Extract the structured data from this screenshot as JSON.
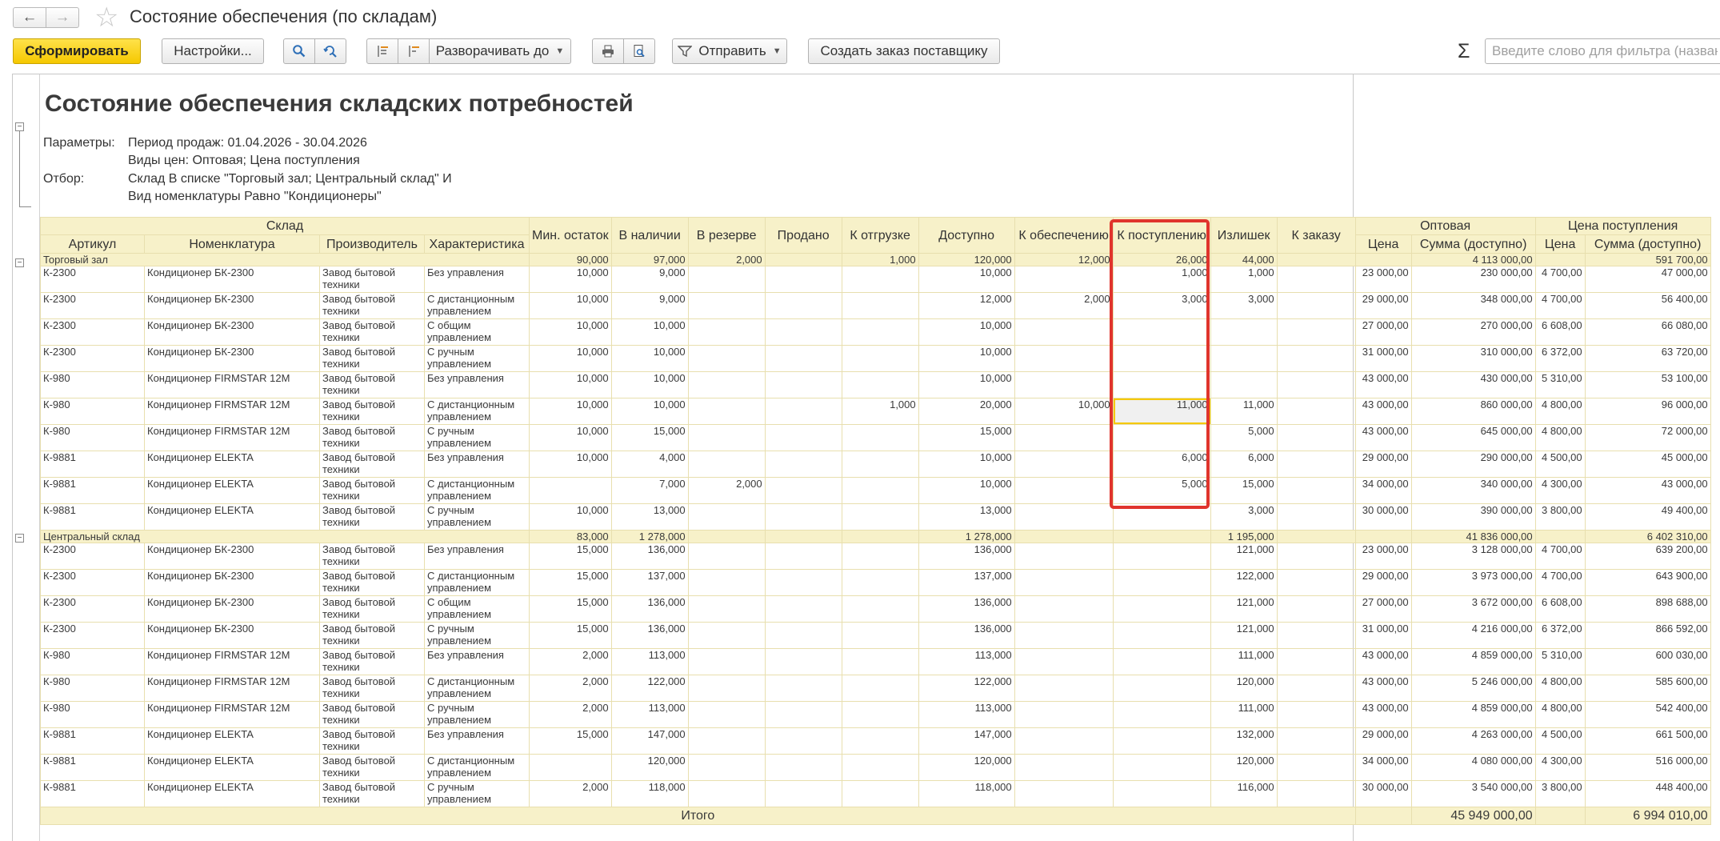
{
  "window": {
    "title": "Состояние обеспечения (по складам)",
    "back_icon": "←",
    "forward_icon": "→",
    "favorite_icon": "☆"
  },
  "toolbar": {
    "generate": "Сформировать",
    "settings": "Настройки...",
    "expand_to": "Разворачивать до",
    "send": "Отправить",
    "create_order": "Создать заказ поставщику",
    "sigma": "Σ",
    "filter_placeholder": "Введите слово для фильтра (назван"
  },
  "report": {
    "title": "Состояние обеспечения складских потребностей",
    "params_label": "Параметры:",
    "params_line1": "Период продаж: 01.04.2026 - 30.04.2026",
    "params_line2": "Виды цен: Оптовая; Цена поступления",
    "filter_label": "Отбор:",
    "filter_line1": "Склад В списке \"Торговый зал; Центральный склад\" И",
    "filter_line2": "Вид номенклатуры Равно \"Кондиционеры\""
  },
  "columns": {
    "warehouse": "Склад",
    "article": "Артикул",
    "item": "Номенклатура",
    "manufacturer": "Производитель",
    "characteristic": "Характеристика",
    "min_stock": "Мин. остаток",
    "in_stock": "В наличии",
    "reserved": "В резерве",
    "sold": "Продано",
    "to_ship": "К отгрузке",
    "available": "Доступно",
    "to_provide": "К обеспечению",
    "to_receive": "К поступлению",
    "surplus": "Излишек",
    "to_order": "К заказу",
    "wholesale": "Оптовая",
    "receipt_price": "Цена поступления",
    "price": "Цена",
    "sum_available": "Сумма (доступно)"
  },
  "groups": [
    {
      "name": "Торговый зал",
      "min": "90,000",
      "stock": "97,000",
      "reserve": "2,000",
      "sold": "",
      "ship": "1,000",
      "avail": "120,000",
      "provide": "12,000",
      "receive": "26,000",
      "surplus": "44,000",
      "order": "",
      "wp": "",
      "ws": "4 113 000,00",
      "rp": "",
      "rs": "591 700,00",
      "rows": [
        {
          "art": "К-2300",
          "item": "Кондиционер БК-2300",
          "man": "Завод бытовой техники",
          "ch": "Без управления",
          "min": "10,000",
          "stock": "9,000",
          "reserve": "",
          "sold": "",
          "ship": "",
          "avail": "10,000",
          "provide": "",
          "receive": "1,000",
          "surplus": "1,000",
          "order": "",
          "wp": "23 000,00",
          "ws": "230 000,00",
          "rp": "4 700,00",
          "rs": "47 000,00"
        },
        {
          "art": "К-2300",
          "item": "Кондиционер БК-2300",
          "man": "Завод бытовой техники",
          "ch": "С дистанционным управлением",
          "min": "10,000",
          "stock": "9,000",
          "reserve": "",
          "sold": "",
          "ship": "",
          "avail": "12,000",
          "provide": "2,000",
          "receive": "3,000",
          "surplus": "3,000",
          "order": "",
          "wp": "29 000,00",
          "ws": "348 000,00",
          "rp": "4 700,00",
          "rs": "56 400,00"
        },
        {
          "art": "К-2300",
          "item": "Кондиционер БК-2300",
          "man": "Завод бытовой техники",
          "ch": "С общим управлением",
          "min": "10,000",
          "stock": "10,000",
          "reserve": "",
          "sold": "",
          "ship": "",
          "avail": "10,000",
          "provide": "",
          "receive": "",
          "surplus": "",
          "order": "",
          "wp": "27 000,00",
          "ws": "270 000,00",
          "rp": "6 608,00",
          "rs": "66 080,00"
        },
        {
          "art": "К-2300",
          "item": "Кондиционер БК-2300",
          "man": "Завод бытовой техники",
          "ch": "С ручным управлением",
          "min": "10,000",
          "stock": "10,000",
          "reserve": "",
          "sold": "",
          "ship": "",
          "avail": "10,000",
          "provide": "",
          "receive": "",
          "surplus": "",
          "order": "",
          "wp": "31 000,00",
          "ws": "310 000,00",
          "rp": "6 372,00",
          "rs": "63 720,00"
        },
        {
          "art": "К-980",
          "item": "Кондиционер FIRMSTAR 12M",
          "man": "Завод бытовой техники",
          "ch": "Без управления",
          "min": "10,000",
          "stock": "10,000",
          "reserve": "",
          "sold": "",
          "ship": "",
          "avail": "10,000",
          "provide": "",
          "receive": "",
          "surplus": "",
          "order": "",
          "wp": "43 000,00",
          "ws": "430 000,00",
          "rp": "5 310,00",
          "rs": "53 100,00"
        },
        {
          "art": "К-980",
          "item": "Кондиционер FIRMSTAR 12M",
          "man": "Завод бытовой техники",
          "ch": "С дистанционным управлением",
          "min": "10,000",
          "stock": "10,000",
          "reserve": "",
          "sold": "",
          "ship": "1,000",
          "avail": "20,000",
          "provide": "10,000",
          "receive": "11,000",
          "surplus": "11,000",
          "order": "",
          "wp": "43 000,00",
          "ws": "860 000,00",
          "rp": "4 800,00",
          "rs": "96 000,00",
          "selected": "yes"
        },
        {
          "art": "К-980",
          "item": "Кондиционер FIRMSTAR 12M",
          "man": "Завод бытовой техники",
          "ch": "С ручным управлением",
          "min": "10,000",
          "stock": "15,000",
          "reserve": "",
          "sold": "",
          "ship": "",
          "avail": "15,000",
          "provide": "",
          "receive": "",
          "surplus": "5,000",
          "order": "",
          "wp": "43 000,00",
          "ws": "645 000,00",
          "rp": "4 800,00",
          "rs": "72 000,00"
        },
        {
          "art": "К-9881",
          "item": "Кондиционер ELEKTA",
          "man": "Завод бытовой техники",
          "ch": "Без управления",
          "min": "10,000",
          "stock": "4,000",
          "reserve": "",
          "sold": "",
          "ship": "",
          "avail": "10,000",
          "provide": "",
          "receive": "6,000",
          "surplus": "6,000",
          "order": "",
          "wp": "29 000,00",
          "ws": "290 000,00",
          "rp": "4 500,00",
          "rs": "45 000,00"
        },
        {
          "art": "К-9881",
          "item": "Кондиционер ELEKTA",
          "man": "Завод бытовой техники",
          "ch": "С дистанционным управлением",
          "min": "",
          "stock": "7,000",
          "reserve": "2,000",
          "sold": "",
          "ship": "",
          "avail": "10,000",
          "provide": "",
          "receive": "5,000",
          "surplus": "15,000",
          "order": "",
          "wp": "34 000,00",
          "ws": "340 000,00",
          "rp": "4 300,00",
          "rs": "43 000,00"
        },
        {
          "art": "К-9881",
          "item": "Кондиционер ELEKTA",
          "man": "Завод бытовой техники",
          "ch": "С ручным управлением",
          "min": "10,000",
          "stock": "13,000",
          "reserve": "",
          "sold": "",
          "ship": "",
          "avail": "13,000",
          "provide": "",
          "receive": "",
          "surplus": "3,000",
          "order": "",
          "wp": "30 000,00",
          "ws": "390 000,00",
          "rp": "3 800,00",
          "rs": "49 400,00"
        }
      ]
    },
    {
      "name": "Центральный склад",
      "min": "83,000",
      "stock": "1 278,000",
      "reserve": "",
      "sold": "",
      "ship": "",
      "avail": "1 278,000",
      "provide": "",
      "receive": "",
      "surplus": "1 195,000",
      "order": "",
      "wp": "",
      "ws": "41 836 000,00",
      "rp": "",
      "rs": "6 402 310,00",
      "rows": [
        {
          "art": "К-2300",
          "item": "Кондиционер БК-2300",
          "man": "Завод бытовой техники",
          "ch": "Без управления",
          "min": "15,000",
          "stock": "136,000",
          "reserve": "",
          "sold": "",
          "ship": "",
          "avail": "136,000",
          "provide": "",
          "receive": "",
          "surplus": "121,000",
          "order": "",
          "wp": "23 000,00",
          "ws": "3 128 000,00",
          "rp": "4 700,00",
          "rs": "639 200,00"
        },
        {
          "art": "К-2300",
          "item": "Кондиционер БК-2300",
          "man": "Завод бытовой техники",
          "ch": "С дистанционным управлением",
          "min": "15,000",
          "stock": "137,000",
          "reserve": "",
          "sold": "",
          "ship": "",
          "avail": "137,000",
          "provide": "",
          "receive": "",
          "surplus": "122,000",
          "order": "",
          "wp": "29 000,00",
          "ws": "3 973 000,00",
          "rp": "4 700,00",
          "rs": "643 900,00"
        },
        {
          "art": "К-2300",
          "item": "Кондиционер БК-2300",
          "man": "Завод бытовой техники",
          "ch": "С общим управлением",
          "min": "15,000",
          "stock": "136,000",
          "reserve": "",
          "sold": "",
          "ship": "",
          "avail": "136,000",
          "provide": "",
          "receive": "",
          "surplus": "121,000",
          "order": "",
          "wp": "27 000,00",
          "ws": "3 672 000,00",
          "rp": "6 608,00",
          "rs": "898 688,00"
        },
        {
          "art": "К-2300",
          "item": "Кондиционер БК-2300",
          "man": "Завод бытовой техники",
          "ch": "С ручным управлением",
          "min": "15,000",
          "stock": "136,000",
          "reserve": "",
          "sold": "",
          "ship": "",
          "avail": "136,000",
          "provide": "",
          "receive": "",
          "surplus": "121,000",
          "order": "",
          "wp": "31 000,00",
          "ws": "4 216 000,00",
          "rp": "6 372,00",
          "rs": "866 592,00"
        },
        {
          "art": "К-980",
          "item": "Кондиционер FIRMSTAR 12M",
          "man": "Завод бытовой техники",
          "ch": "Без управления",
          "min": "2,000",
          "stock": "113,000",
          "reserve": "",
          "sold": "",
          "ship": "",
          "avail": "113,000",
          "provide": "",
          "receive": "",
          "surplus": "111,000",
          "order": "",
          "wp": "43 000,00",
          "ws": "4 859 000,00",
          "rp": "5 310,00",
          "rs": "600 030,00"
        },
        {
          "art": "К-980",
          "item": "Кондиционер FIRMSTAR 12M",
          "man": "Завод бытовой техники",
          "ch": "С дистанционным управлением",
          "min": "2,000",
          "stock": "122,000",
          "reserve": "",
          "sold": "",
          "ship": "",
          "avail": "122,000",
          "provide": "",
          "receive": "",
          "surplus": "120,000",
          "order": "",
          "wp": "43 000,00",
          "ws": "5 246 000,00",
          "rp": "4 800,00",
          "rs": "585 600,00"
        },
        {
          "art": "К-980",
          "item": "Кондиционер FIRMSTAR 12M",
          "man": "Завод бытовой техники",
          "ch": "С ручным управлением",
          "min": "2,000",
          "stock": "113,000",
          "reserve": "",
          "sold": "",
          "ship": "",
          "avail": "113,000",
          "provide": "",
          "receive": "",
          "surplus": "111,000",
          "order": "",
          "wp": "43 000,00",
          "ws": "4 859 000,00",
          "rp": "4 800,00",
          "rs": "542 400,00"
        },
        {
          "art": "К-9881",
          "item": "Кондиционер ELEKTA",
          "man": "Завод бытовой техники",
          "ch": "Без управления",
          "min": "15,000",
          "stock": "147,000",
          "reserve": "",
          "sold": "",
          "ship": "",
          "avail": "147,000",
          "provide": "",
          "receive": "",
          "surplus": "132,000",
          "order": "",
          "wp": "29 000,00",
          "ws": "4 263 000,00",
          "rp": "4 500,00",
          "rs": "661 500,00"
        },
        {
          "art": "К-9881",
          "item": "Кондиционер ELEKTA",
          "man": "Завод бытовой техники",
          "ch": "С дистанционным управлением",
          "min": "",
          "stock": "120,000",
          "reserve": "",
          "sold": "",
          "ship": "",
          "avail": "120,000",
          "provide": "",
          "receive": "",
          "surplus": "120,000",
          "order": "",
          "wp": "34 000,00",
          "ws": "4 080 000,00",
          "rp": "4 300,00",
          "rs": "516 000,00"
        },
        {
          "art": "К-9881",
          "item": "Кондиционер ELEKTA",
          "man": "Завод бытовой техники",
          "ch": "С ручным управлением",
          "min": "2,000",
          "stock": "118,000",
          "reserve": "",
          "sold": "",
          "ship": "",
          "avail": "118,000",
          "provide": "",
          "receive": "",
          "surplus": "116,000",
          "order": "",
          "wp": "30 000,00",
          "ws": "3 540 000,00",
          "rp": "3 800,00",
          "rs": "448 400,00"
        }
      ]
    }
  ],
  "total": {
    "label": "Итого",
    "ws": "45 949 000,00",
    "rs": "6 994 010,00"
  },
  "colors": {
    "generate_button": "#f5c800",
    "header_bg": "#f7f1c9",
    "highlight_frame": "#e0342c"
  }
}
